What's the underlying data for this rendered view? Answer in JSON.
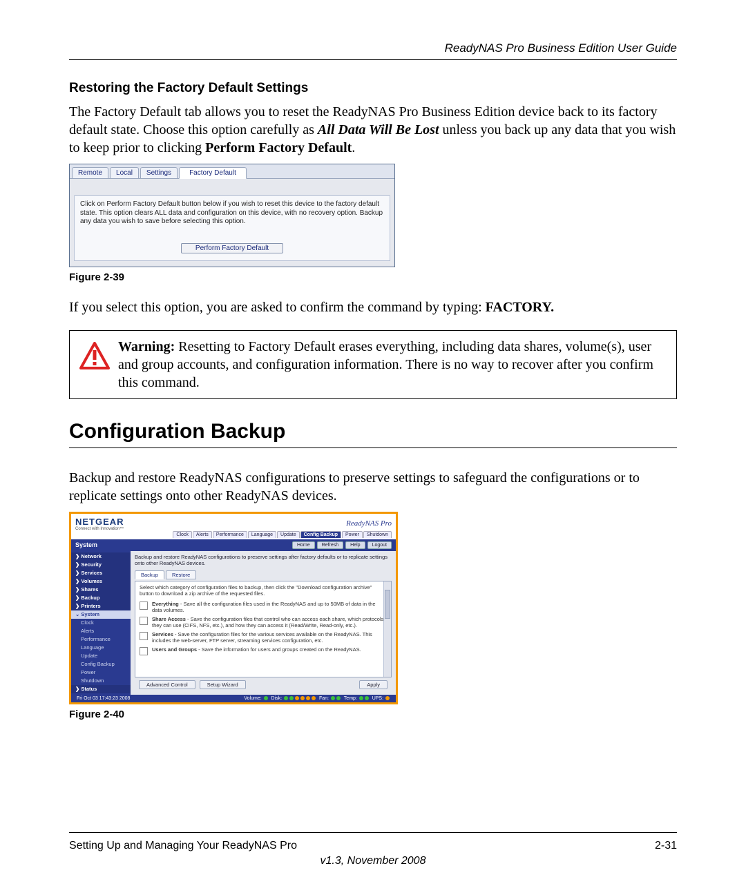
{
  "header_guide": "ReadyNAS Pro Business Edition User Guide",
  "section_title": "Restoring the Factory Default Settings",
  "para1_a": "The Factory Default tab allows you to reset the ReadyNAS Pro Business Edition device back to its factory default state. Choose this option carefully as ",
  "para1_b": "All Data Will Be Lost",
  "para1_c": " unless you back up any data that you wish to keep prior to clicking ",
  "para1_d": "Perform Factory Default",
  "para1_e": ".",
  "fig39": {
    "tabs": {
      "remote": "Remote",
      "local": "Local",
      "settings": "Settings",
      "factory": "Factory Default"
    },
    "desc": "Click on Perform Factory Default button below if you wish to reset this device to the factory default state. This option clears ALL data and configuration on this device, with no recovery option. Backup any data you wish to save before selecting this option.",
    "button": "Perform Factory Default",
    "caption": "Figure 2-39"
  },
  "para2_a": "If you select this option, you are asked to confirm the command by typing: ",
  "para2_b": "FACTORY.",
  "warning": {
    "label": "Warning:",
    "text": " Resetting to Factory Default erases everything, including data shares, volume(s), user and group accounts, and configuration information. There is no way to recover after you confirm this command."
  },
  "h2": "Configuration Backup",
  "para3": "Backup and restore ReadyNAS configurations to preserve settings to safeguard the configurations or to replicate settings onto other ReadyNAS devices.",
  "fig40": {
    "logo": "NETGEAR",
    "logo_sub": "Connect with Innovation™",
    "product": "ReadyNAS Pro",
    "toptabs": {
      "clock": "Clock",
      "alerts": "Alerts",
      "perf": "Performance",
      "lang": "Language",
      "update": "Update",
      "config": "Config Backup",
      "power": "Power",
      "shutdown": "Shutdown"
    },
    "bar_title": "System",
    "bar_buttons": {
      "home": "Home",
      "refresh": "Refresh",
      "help": "Help",
      "logout": "Logout"
    },
    "side": {
      "network": "Network",
      "security": "Security",
      "services": "Services",
      "volumes": "Volumes",
      "shares": "Shares",
      "backup": "Backup",
      "printers": "Printers",
      "system": "System",
      "clock": "Clock",
      "alerts": "Alerts",
      "performance": "Performance",
      "language": "Language",
      "update": "Update",
      "config_backup": "Config Backup",
      "power": "Power",
      "shutdown": "Shutdown",
      "status": "Status"
    },
    "content_desc": "Backup and restore ReadyNAS configurations to preserve settings after factory defaults or to replicate settings onto other ReadyNAS devices.",
    "subtabs": {
      "backup": "Backup",
      "restore": "Restore"
    },
    "panel_desc": "Select which category of configuration files to backup, then click the \"Download configuration archive\" button to download a zip archive of the requested files.",
    "opts": {
      "everything": "Everything - Save all the configuration files used in the ReadyNAS and up to 50MB of data in the data volumes.",
      "share": "Share Access - Save the configuration files that control who can access each share, which protocols they can use (CIFS, NFS, etc.), and how they can access it (Read/Write, Read-only, etc.).",
      "services": "Services - Save the configuration files for the various services available on the ReadyNAS. This includes the web-server, FTP server, streaming services configuration, etc.",
      "users": "Users and Groups - Save the information for users and groups created on the ReadyNAS."
    },
    "bottom": {
      "adv": "Advanced Control",
      "wizard": "Setup Wizard",
      "apply": "Apply"
    },
    "status": {
      "date": "Fri Oct 03  17:43:23 2008",
      "volume": "Volume:",
      "disk": "Disk:",
      "fan": "Fan:",
      "temp": "Temp:",
      "ups": "UPS:"
    },
    "caption": "Figure 2-40"
  },
  "footer": {
    "left": "Setting Up and Managing Your ReadyNAS Pro",
    "right": "2-31",
    "center": "v1.3, November 2008"
  }
}
